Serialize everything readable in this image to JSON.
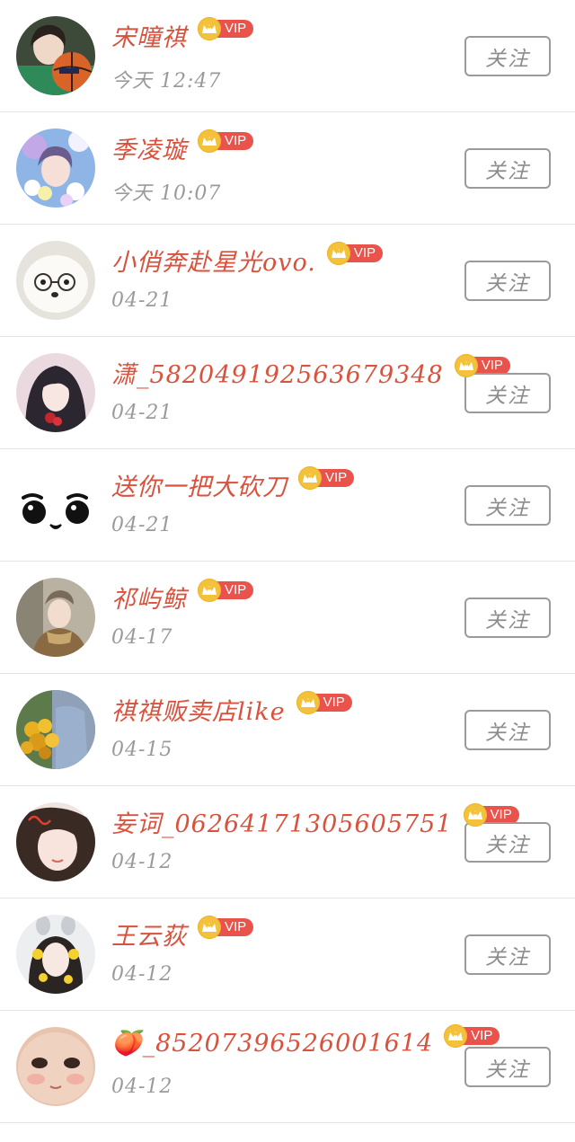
{
  "vip_label": "VIP",
  "follow_label": "关注",
  "colors": {
    "name": "#d8523d",
    "time": "#9a9a9a",
    "vip_badge": "#e9534b",
    "vip_crown": "#f4c23a",
    "divider": "#e4e4e4"
  },
  "users": [
    {
      "name": "宋曈祺",
      "time": "今天 12:47",
      "avatar": "photo-avatar-basketball"
    },
    {
      "name": "季凌璇",
      "time": "今天 10:07",
      "avatar": "photo-avatar-flowers"
    },
    {
      "name": "小俏奔赴星光ovo.",
      "time": "04-21",
      "avatar": "photo-avatar-white-dog"
    },
    {
      "name": "潇_582049192563679348",
      "time": "04-21",
      "avatar": "photo-avatar-anime-girl"
    },
    {
      "name": "送你一把大砍刀",
      "time": "04-21",
      "avatar": "emoji-face-avatar"
    },
    {
      "name": "祁屿鲸",
      "time": "04-17",
      "avatar": "photo-avatar-girl-beret"
    },
    {
      "name": "祺祺贩卖店like",
      "time": "04-15",
      "avatar": "photo-avatar-sunflowers"
    },
    {
      "name": "妄词_06264171305605751",
      "time": "04-12",
      "avatar": "photo-avatar-girl-closeup"
    },
    {
      "name": "王云荻",
      "time": "04-12",
      "avatar": "photo-avatar-bunny-ears"
    },
    {
      "name": "🍑_85207396526001614",
      "time": "04-12",
      "avatar": "photo-avatar-baby-face"
    }
  ]
}
